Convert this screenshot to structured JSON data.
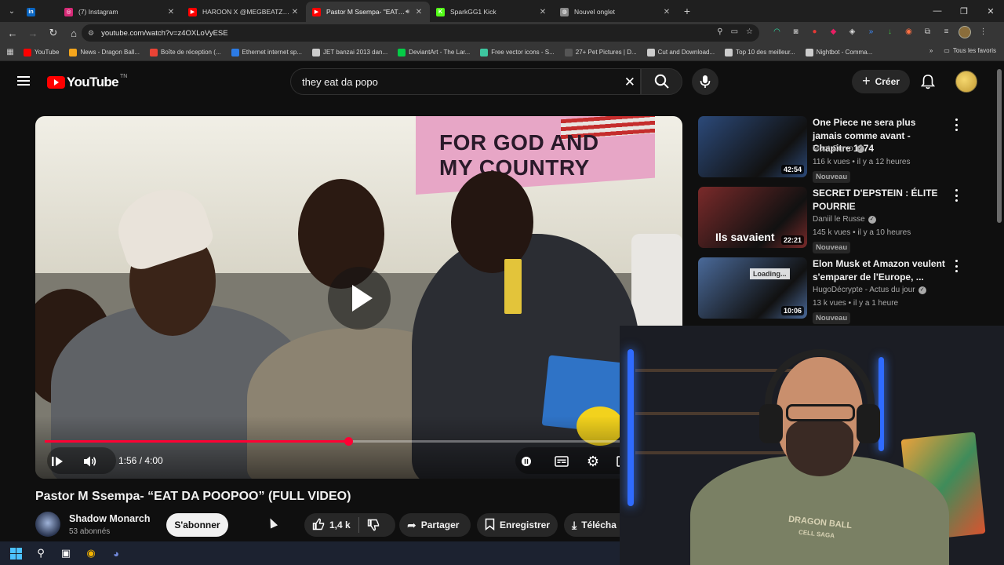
{
  "browser": {
    "tabs": [
      {
        "label": "",
        "icon": "linkedin-icon",
        "color": "#0a66c2",
        "glyph": "in"
      },
      {
        "label": "(7) Instagram",
        "icon": "instagram-icon",
        "color": "#d62976",
        "glyph": "◎"
      },
      {
        "label": "HAROON X @MEGBEATZ - Hat",
        "icon": "youtube-icon",
        "color": "#ff0000",
        "glyph": "▶"
      },
      {
        "label": "Pastor M Ssempa- \"EAT DA",
        "icon": "youtube-icon",
        "color": "#ff0000",
        "glyph": "▶",
        "active": true
      },
      {
        "label": "SparkGG1 Kick",
        "icon": "kick-icon",
        "color": "#53fc18",
        "glyph": "K"
      },
      {
        "label": "Nouvel onglet",
        "icon": "chrome-icon",
        "color": "#888888",
        "glyph": "◍"
      }
    ],
    "url": "youtube.com/watch?v=z4OXLoVyESE",
    "bookmarks": [
      {
        "label": "YouTube",
        "color": "#ff0000"
      },
      {
        "label": "News - Dragon Ball...",
        "color": "#f4a51c"
      },
      {
        "label": "Boîte de réception (...",
        "color": "#ea4335"
      },
      {
        "label": "Ethernet internet sp...",
        "color": "#2c7be5"
      },
      {
        "label": "JET banzai 2013 dan...",
        "color": "#cccccc"
      },
      {
        "label": "DeviantArt - The Lar...",
        "color": "#05cc47"
      },
      {
        "label": "Free vector icons - S...",
        "color": "#3ec7a0"
      },
      {
        "label": "27+ Pet Pictures | D...",
        "color": "#555555"
      },
      {
        "label": "Cut and Download...",
        "color": "#cccccc"
      },
      {
        "label": "Top 10 des meilleur...",
        "color": "#cccccc"
      },
      {
        "label": "Nightbot - Comma...",
        "color": "#cccccc"
      }
    ],
    "all_bookmarks": "Tous les favoris"
  },
  "youtube": {
    "logo_text": "YouTube",
    "logo_country": "TN",
    "search_query": "they eat da popo",
    "create_label": "Créer",
    "video": {
      "title": "Pastor M Ssempa- “EAT DA POOPOO” (FULL VIDEO)",
      "time": "1:56 / 4:00",
      "progress": 0.4833,
      "banner_text": "FOR GOD AND\nMY COUNTRY"
    },
    "channel": {
      "name": "Shadow Monarch",
      "subs": "53 abonnés",
      "subscribe_label": "S'abonner"
    },
    "actions": {
      "likes": "1,4 k",
      "share": "Partager",
      "save": "Enregistrer",
      "download": "Télécha"
    },
    "recommendations": [
      {
        "title": "One Piece ne sera plus jamais comme avant - Chapitre 1174",
        "channel": "Mont Corvo",
        "meta": "116 k vues • il y a 12 heures",
        "badge": "Nouveau",
        "duration": "42:54",
        "thumb_color": "#2c4a7a"
      },
      {
        "title": "SECRET D'EPSTEIN : ÉLITE POURRIE",
        "channel": "Daniil le Russe",
        "meta": "145 k vues • il y a 10 heures",
        "badge": "Nouveau",
        "duration": "22:21",
        "thumb_text": "Ils savaient",
        "thumb_color": "#7a2a2a"
      },
      {
        "title": "Elon Musk et Amazon veulent s'emparer de l'Europe, ...",
        "channel": "HugoDécrypte - Actus du jour",
        "meta": "13 k vues • il y a 1 heure",
        "badge": "Nouveau",
        "duration": "10:06",
        "thumb_text": "Loading...",
        "thumb_color": "#4a6a9a"
      }
    ]
  },
  "webcam": {
    "hoodie_text": "DRAGON BALL",
    "hoodie_subtext": "CELL SAGA"
  }
}
